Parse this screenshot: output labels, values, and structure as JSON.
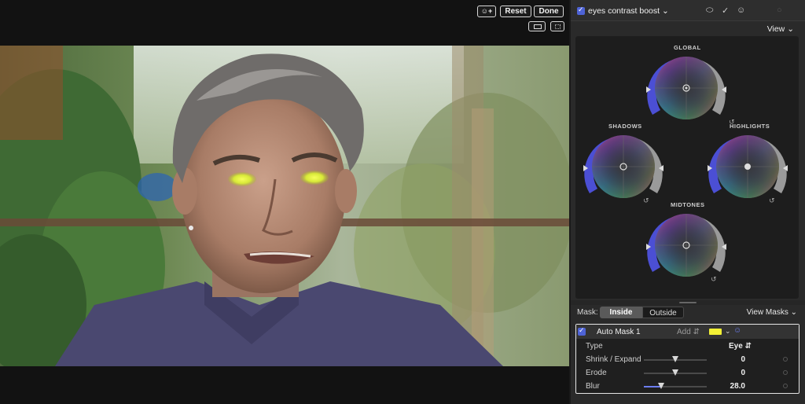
{
  "viewer": {
    "reset_label": "Reset",
    "done_label": "Done"
  },
  "inspector": {
    "effect_name": "eyes contrast boost",
    "view_label": "View"
  },
  "wheels": {
    "global_label": "GLOBAL",
    "shadows_label": "SHADOWS",
    "highlights_label": "HIGHLIGHTS",
    "midtones_label": "MIDTONES"
  },
  "mask": {
    "mask_label": "Mask:",
    "inside_label": "Inside",
    "outside_label": "Outside",
    "view_masks_label": "View Masks",
    "auto_mask_name": "Auto Mask 1",
    "add_label": "Add",
    "swatch_color": "#f2f035",
    "params": {
      "type_label": "Type",
      "type_value": "Eye",
      "shrink_label": "Shrink / Expand",
      "shrink_value": "0",
      "erode_label": "Erode",
      "erode_value": "0",
      "blur_label": "Blur",
      "blur_value": "28.0"
    }
  },
  "colors": {
    "accent": "#4e63d6",
    "mask_highlight": "#f2f035"
  }
}
